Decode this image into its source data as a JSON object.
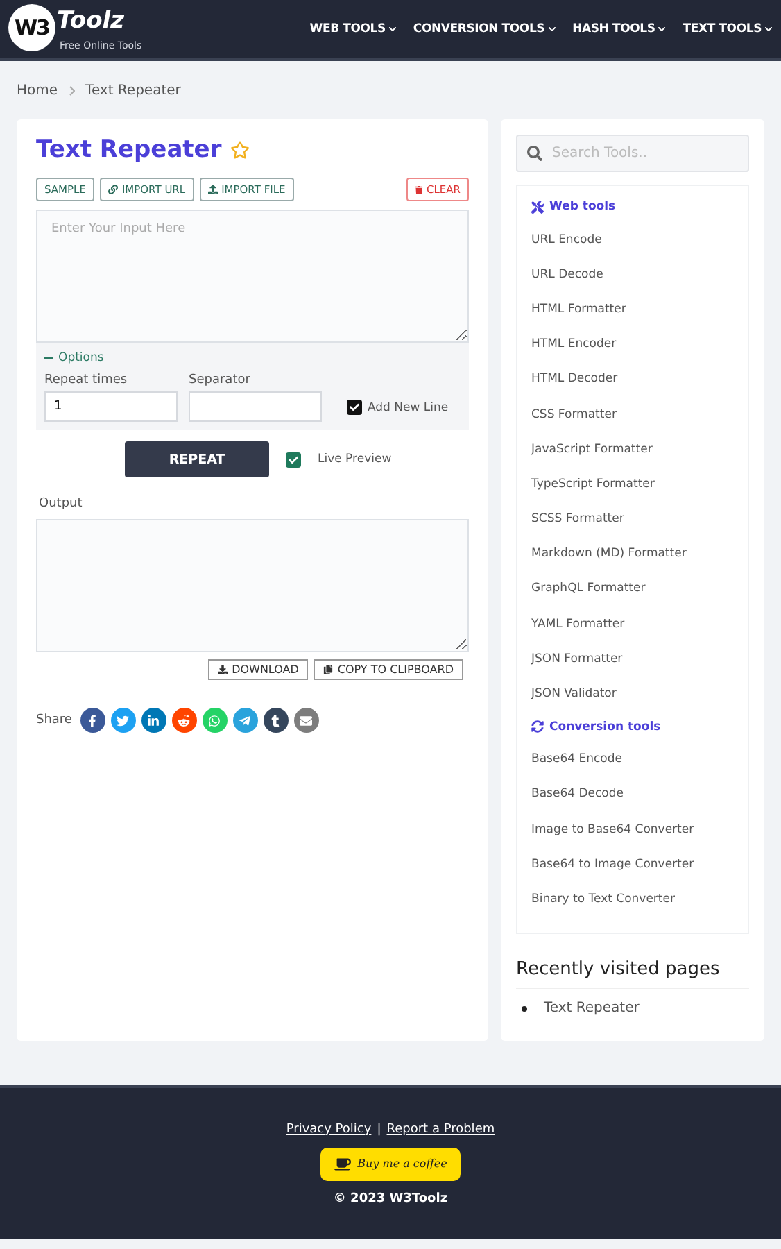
{
  "header": {
    "logo": {
      "mark": "W3",
      "name": "Toolz",
      "tagline": "Free Online Tools"
    },
    "nav": [
      {
        "label": "WEB TOOLS"
      },
      {
        "label": "CONVERSION TOOLS"
      },
      {
        "label": "HASH TOOLS"
      },
      {
        "label": "TEXT TOOLS"
      }
    ]
  },
  "breadcrumb": [
    "Home",
    "Text Repeater"
  ],
  "tool": {
    "title": "Text Repeater",
    "favorite": false,
    "actions": [
      {
        "label": "SAMPLE",
        "kind": "plain"
      },
      {
        "label": "IMPORT URL",
        "kind": "link"
      },
      {
        "label": "IMPORT FILE",
        "kind": "upload"
      }
    ],
    "clear": "CLEAR",
    "input": {
      "placeholder": "Enter Your Input Here"
    },
    "options": {
      "toggle": "Options",
      "expanded": true,
      "repeat_label": "Repeat times",
      "repeat_value": "1",
      "separator_label": "Separator",
      "add_new_line": {
        "label": "Add New Line",
        "checked": true
      }
    },
    "repeat_button": "REPEAT",
    "live_preview": {
      "label": "Live Preview",
      "checked": true
    },
    "output_label": "Output",
    "output_buttons": [
      {
        "label": "DOWNLOAD",
        "kind": "download"
      },
      {
        "label": "COPY TO CLIPBOARD",
        "kind": "copy"
      }
    ],
    "share": {
      "label": "Share",
      "networks": [
        {
          "kind": "facebook",
          "color": "#3b5998"
        },
        {
          "kind": "twitter",
          "color": "#1da1f2"
        },
        {
          "kind": "linkedin",
          "color": "#0077b5"
        },
        {
          "kind": "reddit",
          "color": "#ff4500"
        },
        {
          "kind": "whatsapp",
          "color": "#25d366"
        },
        {
          "kind": "telegram",
          "color": "#2aa3dc"
        },
        {
          "kind": "tumblr",
          "color": "#35465c"
        },
        {
          "kind": "email",
          "color": "#7d7d7d"
        }
      ]
    }
  },
  "sidebar": {
    "search": {
      "placeholder": "Search Tools.."
    },
    "groups": [
      {
        "title": "Web tools",
        "kind": "web",
        "items": [
          "URL Encode",
          "URL Decode",
          "HTML Formatter",
          "HTML Encoder",
          "HTML Decoder",
          "CSS Formatter",
          "JavaScript Formatter",
          "TypeScript Formatter",
          "SCSS Formatter",
          "Markdown (MD) Formatter",
          "GraphQL Formatter",
          "YAML Formatter",
          "JSON Formatter",
          "JSON Validator"
        ]
      },
      {
        "title": "Conversion tools",
        "kind": "conversion",
        "items": [
          "Base64 Encode",
          "Base64 Decode",
          "Image to Base64 Converter",
          "Base64 to Image Converter",
          "Binary to Text Converter"
        ]
      }
    ],
    "recent": {
      "title": "Recently visited pages",
      "items": [
        "Text Repeater"
      ]
    }
  },
  "footer": {
    "links": [
      "Privacy Policy",
      "Report a Problem"
    ],
    "separator": "|",
    "coffee": "Buy me a coffee",
    "copyright": "© 2023 W3Toolz"
  }
}
